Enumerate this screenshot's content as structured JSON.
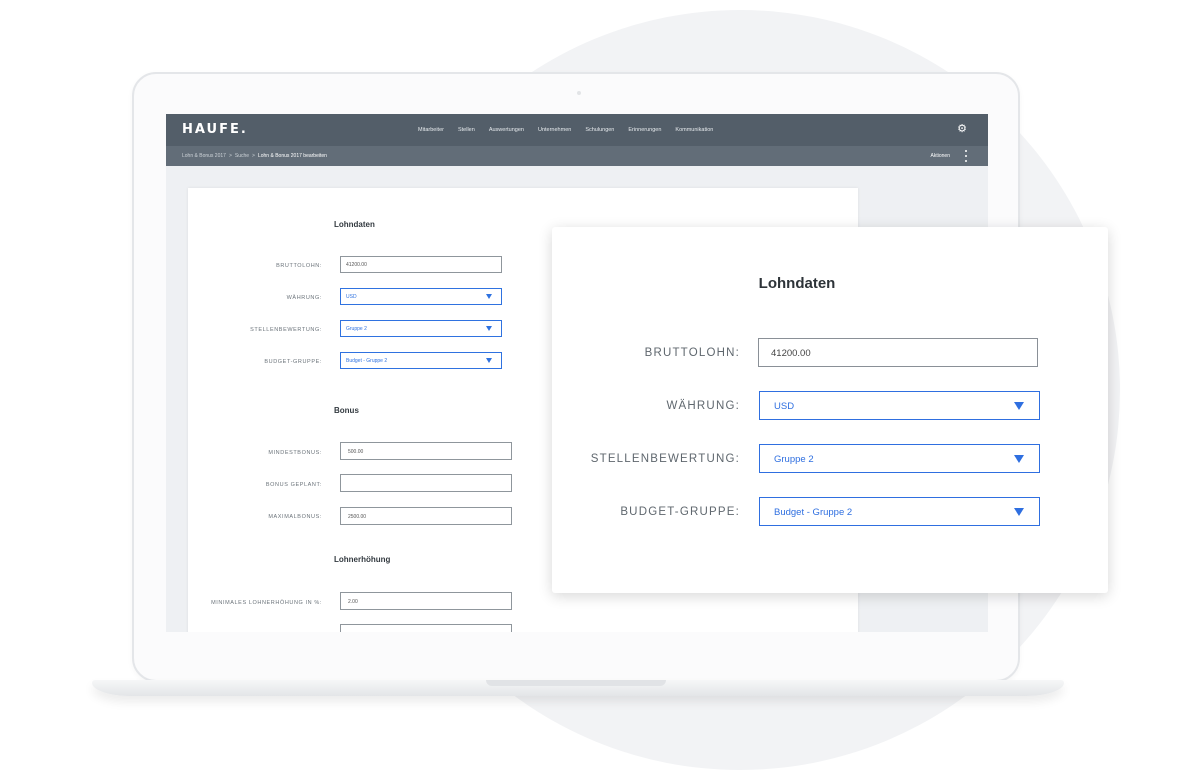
{
  "app": {
    "logo": "HAUFE.",
    "nav": [
      "Mitarbeiter",
      "Stellen",
      "Auswertungen",
      "Unternehmen",
      "Schulungen",
      "Erinnerungen",
      "Kommunikation"
    ],
    "breadcrumb": [
      "Lohn & Bonus 2017",
      "Suche",
      "Lohn & Bonus 2017 bearbeiten"
    ],
    "breadcrumb_sep": ">",
    "actions_label": "Aktionen"
  },
  "form_small": {
    "lohndaten_heading": "Lohndaten",
    "bruttolohn_label": "BRUTTOLOHN:",
    "bruttolohn_value": "41200.00",
    "waehrung_label": "WÄHRUNG:",
    "waehrung_value": "USD",
    "stellenbewertung_label": "STELLENBEWERTUNG:",
    "stellenbewertung_value": "Gruppe 2",
    "budget_label": "BUDGET-GRUPPE:",
    "budget_value": "Budget - Gruppe 2",
    "bonus_heading": "Bonus",
    "mindestbonus_label": "MINDESTBONUS:",
    "mindestbonus_value": "500.00",
    "bonus_geplant_label": "BONUS GEPLANT:",
    "bonus_geplant_value": "",
    "maximalbonus_label": "MAXIMALBONUS:",
    "maximalbonus_value": "2500.00",
    "lohnerhoehung_heading": "Lohnerhöhung",
    "min_lohnerhoehung_label": "MINIMALES LOHNERHÖHUNG IN %:",
    "min_lohnerhoehung_value": "2.00"
  },
  "form_big": {
    "heading": "Lohndaten",
    "bruttolohn_label": "BRUTTOLOHN:",
    "bruttolohn_value": "41200.00",
    "waehrung_label": "WÄHRUNG:",
    "waehrung_value": "USD",
    "stellenbewertung_label": "STELLENBEWERTUNG:",
    "stellenbewertung_value": "Gruppe 2",
    "budget_label": "BUDGET-GRUPPE:",
    "budget_value": "Budget - Gruppe 2"
  },
  "colors": {
    "header_bg": "#535e69",
    "subbar_bg": "#626d78",
    "accent_blue": "#2f6fe0",
    "input_border": "#8a9097"
  },
  "icons": [
    "gear-icon",
    "kebab-menu-icon",
    "dropdown-arrow-icon"
  ]
}
